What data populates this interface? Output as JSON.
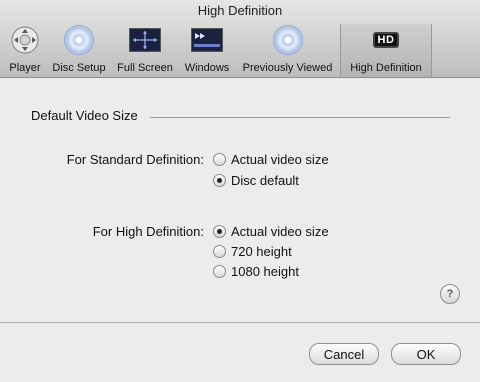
{
  "window": {
    "title": "High Definition"
  },
  "toolbar": {
    "items": [
      {
        "label": "Player",
        "icon": "player-control-icon"
      },
      {
        "label": "Disc Setup",
        "icon": "disc-icon"
      },
      {
        "label": "Full Screen",
        "icon": "fullscreen-icon"
      },
      {
        "label": "Windows",
        "icon": "windows-icon"
      },
      {
        "label": "Previously Viewed",
        "icon": "disc-icon"
      },
      {
        "label": "High Definition",
        "icon": "hd-icon",
        "selected": true
      }
    ],
    "hd_glyph": "HD"
  },
  "section": {
    "title": "Default Video Size"
  },
  "standard": {
    "label": "For Standard Definition:",
    "options": [
      {
        "label": "Actual video size",
        "selected": false
      },
      {
        "label": "Disc default",
        "selected": true
      }
    ]
  },
  "high": {
    "label": "For High Definition:",
    "options": [
      {
        "label": "Actual video size",
        "selected": true
      },
      {
        "label": "720 height",
        "selected": false
      },
      {
        "label": "1080 height",
        "selected": false
      }
    ]
  },
  "help": {
    "glyph": "?"
  },
  "buttons": {
    "cancel": "Cancel",
    "ok": "OK"
  }
}
